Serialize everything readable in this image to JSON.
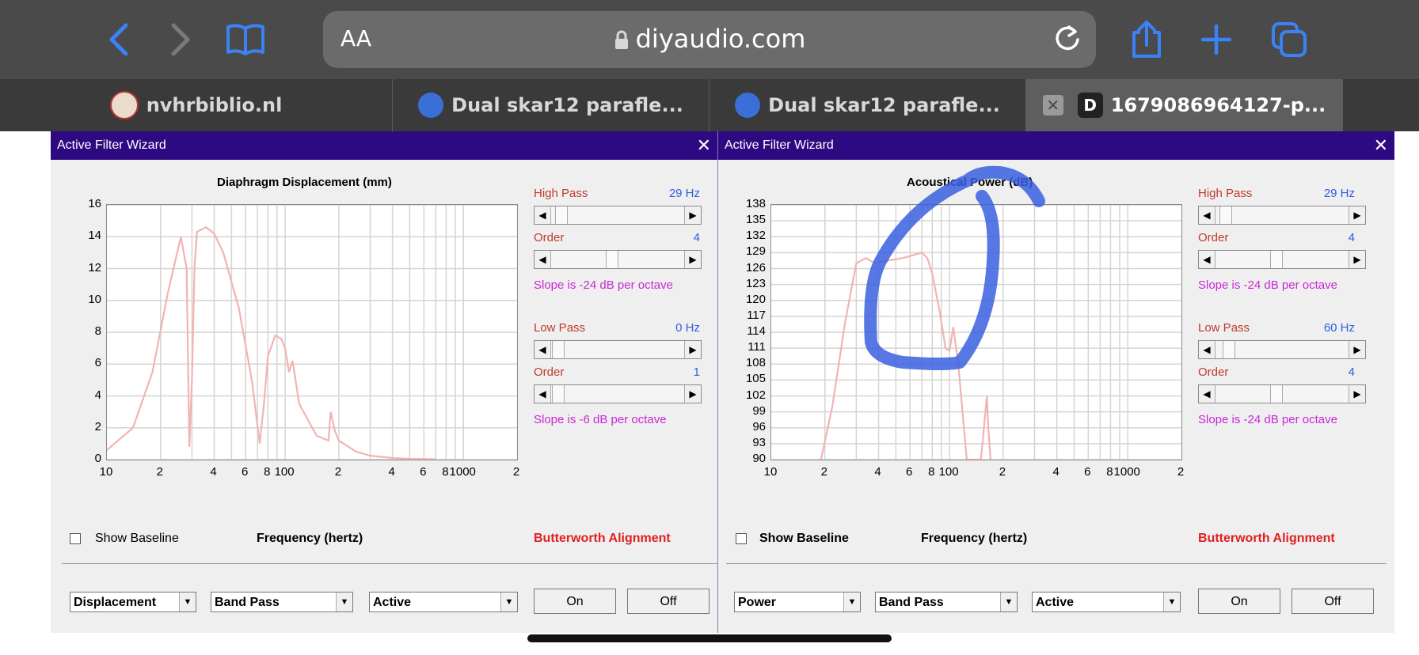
{
  "browser": {
    "url": "diyaudio.com",
    "aa_label": "AA",
    "tabs": [
      {
        "label": "nvhrbiblio.nl"
      },
      {
        "label": "Dual skar12 parafle..."
      },
      {
        "label": "Dual skar12 parafle..."
      },
      {
        "label": "1679086964127-p...",
        "badge": "D"
      }
    ]
  },
  "left_window": {
    "title": "Active Filter Wizard",
    "chart_title": "Diaphragm Displacement (mm)",
    "x_axis_label": "Frequency (hertz)",
    "show_baseline": "Show Baseline",
    "alignment": "Butterworth Alignment",
    "high_pass": {
      "label": "High Pass",
      "value": "29 Hz"
    },
    "hp_order": {
      "label": "Order",
      "value": "4"
    },
    "hp_slope": "Slope is -24 dB per octave",
    "low_pass": {
      "label": "Low Pass",
      "value": "0 Hz"
    },
    "lp_order": {
      "label": "Order",
      "value": "1"
    },
    "lp_slope": "Slope is -6 dB per octave",
    "dropdowns": [
      "Displacement",
      "Band Pass",
      "Active"
    ],
    "on_label": "On",
    "off_label": "Off"
  },
  "right_window": {
    "title": "Active Filter Wizard",
    "chart_title": "Acoustical Power (dB)",
    "x_axis_label": "Frequency (hertz)",
    "show_baseline": "Show Baseline",
    "alignment": "Butterworth Alignment",
    "high_pass": {
      "label": "High Pass",
      "value": "29 Hz"
    },
    "hp_order": {
      "label": "Order",
      "value": "4"
    },
    "hp_slope": "Slope is -24 dB per octave",
    "low_pass": {
      "label": "Low Pass",
      "value": "60 Hz"
    },
    "lp_order": {
      "label": "Order",
      "value": "4"
    },
    "lp_slope": "Slope is -24 dB per octave",
    "dropdowns": [
      "Power",
      "Band Pass",
      "Active"
    ],
    "on_label": "On",
    "off_label": "Off"
  },
  "chart_data": [
    {
      "type": "line",
      "title": "Diaphragm Displacement (mm)",
      "xlabel": "Frequency (hertz)",
      "x_scale": "log",
      "xlim": [
        10,
        2000
      ],
      "x_tick_labels": [
        "10",
        "2",
        "4",
        "6",
        "8",
        "100",
        "2",
        "4",
        "6",
        "8",
        "1000",
        "2"
      ],
      "ylim": [
        0,
        16
      ],
      "y_ticks": [
        0,
        2,
        4,
        6,
        8,
        10,
        12,
        14,
        16
      ],
      "grid": true,
      "color": "#f2b3b3",
      "x": [
        10,
        14,
        18,
        22,
        26,
        28,
        29,
        30,
        31,
        32,
        36,
        40,
        45,
        55,
        65,
        72,
        76,
        80,
        88,
        95,
        100,
        105,
        110,
        120,
        150,
        175,
        180,
        190,
        200,
        250,
        300,
        400,
        500,
        700
      ],
      "values": [
        0.6,
        2.0,
        5.5,
        10.5,
        14.0,
        12.0,
        0.8,
        5.0,
        12.0,
        14.3,
        14.6,
        14.2,
        13.0,
        9.5,
        5.0,
        1.0,
        3.5,
        6.5,
        7.8,
        7.6,
        7.0,
        5.5,
        6.2,
        3.5,
        1.5,
        1.2,
        3.0,
        1.8,
        1.2,
        0.5,
        0.25,
        0.1,
        0.05,
        0.02
      ]
    },
    {
      "type": "line",
      "title": "Acoustical Power (dB)",
      "xlabel": "Frequency (hertz)",
      "x_scale": "log",
      "xlim": [
        10,
        2000
      ],
      "x_tick_labels": [
        "10",
        "2",
        "4",
        "6",
        "8",
        "100",
        "2",
        "4",
        "6",
        "8",
        "1000",
        "2"
      ],
      "ylim": [
        90,
        138
      ],
      "y_ticks": [
        90,
        93,
        96,
        99,
        102,
        105,
        108,
        111,
        114,
        117,
        120,
        123,
        126,
        129,
        132,
        135,
        138
      ],
      "grid": true,
      "color": "#f2b3b3",
      "x": [
        19,
        22,
        26,
        30,
        34,
        38,
        45,
        55,
        70,
        75,
        80,
        88,
        95,
        100,
        105,
        112,
        125,
        140,
        150,
        160,
        162,
        165,
        170
      ],
      "values": [
        90,
        100,
        116,
        127,
        128,
        127,
        127.5,
        128,
        129,
        128,
        125,
        118,
        111,
        110.5,
        115,
        108,
        90,
        90,
        90,
        100,
        102,
        96,
        90
      ]
    }
  ]
}
